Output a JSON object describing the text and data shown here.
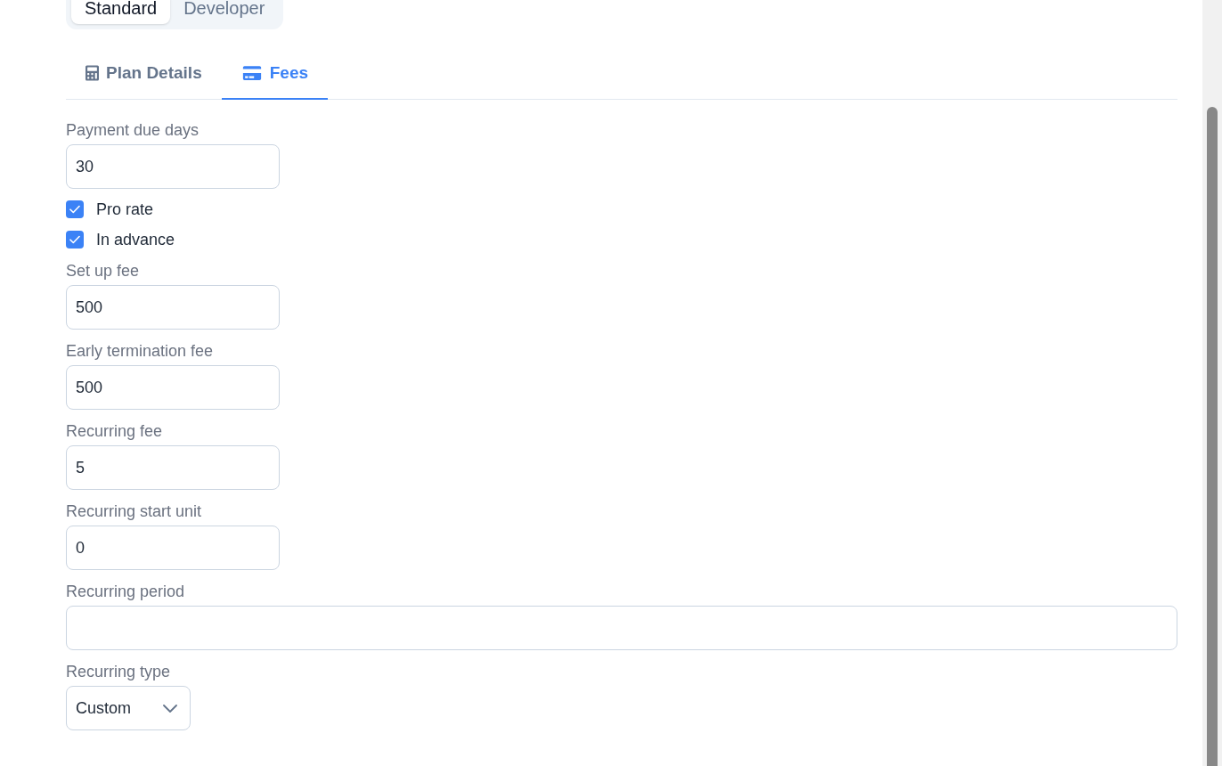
{
  "mode_switch": [
    {
      "label": "Standard",
      "selected": true
    },
    {
      "label": "Developer",
      "selected": false
    }
  ],
  "tabs": [
    {
      "label": "Plan Details",
      "selected": false
    },
    {
      "label": "Fees",
      "selected": true
    }
  ],
  "form": {
    "fields": [
      {
        "kind": "number",
        "label": "Payment due days",
        "value": "30"
      },
      {
        "kind": "checkbox",
        "label": "Pro rate",
        "checked": true
      },
      {
        "kind": "checkbox",
        "label": "In advance",
        "checked": true
      },
      {
        "kind": "number",
        "label": "Set up fee",
        "value": "500"
      },
      {
        "kind": "number",
        "label": "Early termination fee",
        "value": "500"
      },
      {
        "kind": "number",
        "label": "Recurring fee",
        "value": "5"
      },
      {
        "kind": "number",
        "label": "Recurring start unit",
        "value": "0"
      },
      {
        "kind": "text",
        "label": "Recurring period"
      },
      {
        "kind": "select",
        "label": "Recurring type",
        "value": "Custom"
      }
    ]
  }
}
